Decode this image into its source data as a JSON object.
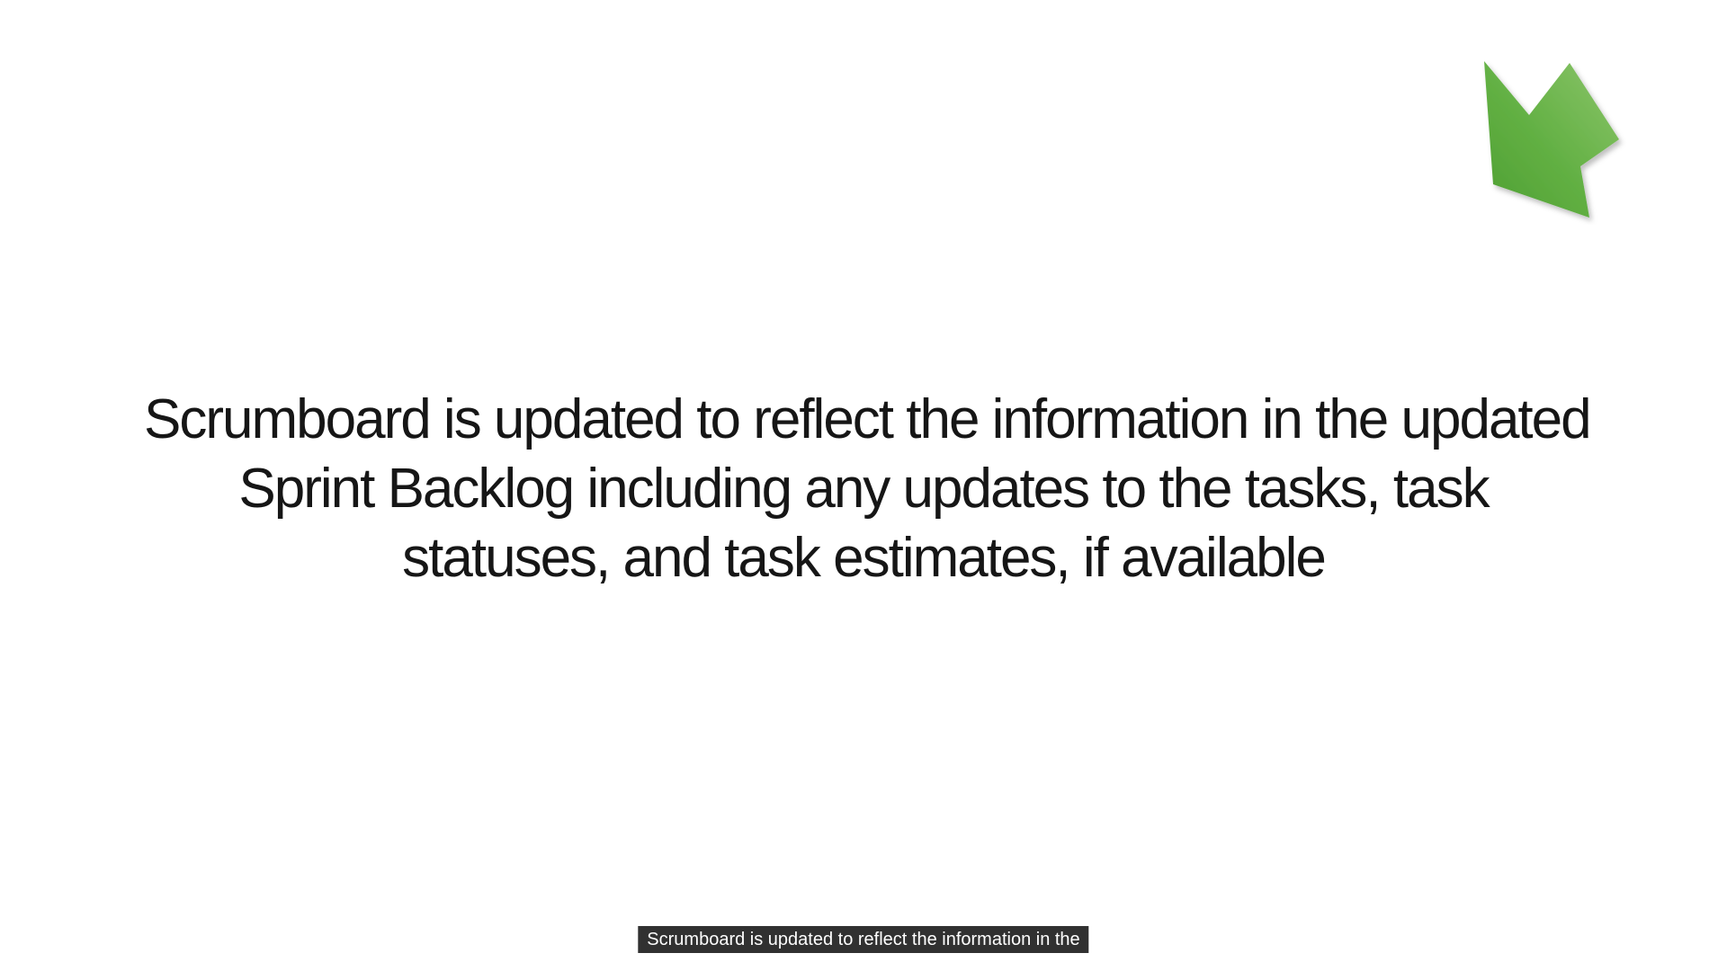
{
  "slide": {
    "lines": [
      "Scrumboard is updated to reflect the information in the updated",
      "Sprint Backlog including any updates to the tasks, task",
      "statuses, and task estimates, if available"
    ],
    "arrow_icon": "arrow-down-left-icon",
    "arrow_color": "#5aab3c"
  },
  "caption": {
    "text": "Scrumboard is updated to reflect the information in the"
  }
}
